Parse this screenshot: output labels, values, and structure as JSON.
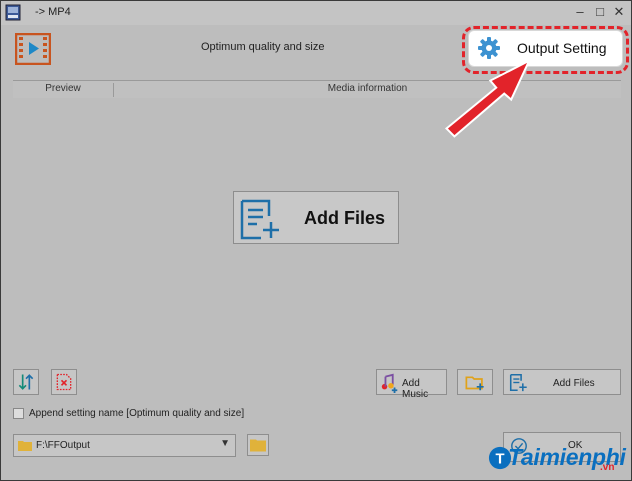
{
  "window": {
    "title": "-> MP4",
    "minimize": "–",
    "maximize": "□",
    "close": "✕"
  },
  "header": {
    "preset_label": "Optimum quality and size",
    "output_setting_label": "Output Setting"
  },
  "table": {
    "columns": [
      "Preview",
      "Media information"
    ]
  },
  "main": {
    "add_files_big_label": "Add Files"
  },
  "toolbar": {
    "add_music_label": "Add Music",
    "add_files_label": "Add Files"
  },
  "options": {
    "append_setting_label": "Append setting name [Optimum quality and size]",
    "append_setting_checked": false
  },
  "output": {
    "folder_path": "F:\\FFOutput",
    "ok_label": "OK"
  },
  "watermark": {
    "brand": "Taimienphi",
    "suffix": ".vn"
  },
  "colors": {
    "accent": "#1e6fa8",
    "highlight": "#e2232a",
    "window_bg": "#bdbdbd"
  },
  "icons": [
    "app-video-icon",
    "gear-icon",
    "add-files-icon",
    "sort-icon",
    "remove-icon",
    "add-music-icon",
    "add-folder-icon",
    "folder-icon",
    "ok-icon",
    "arrow-pointer"
  ]
}
